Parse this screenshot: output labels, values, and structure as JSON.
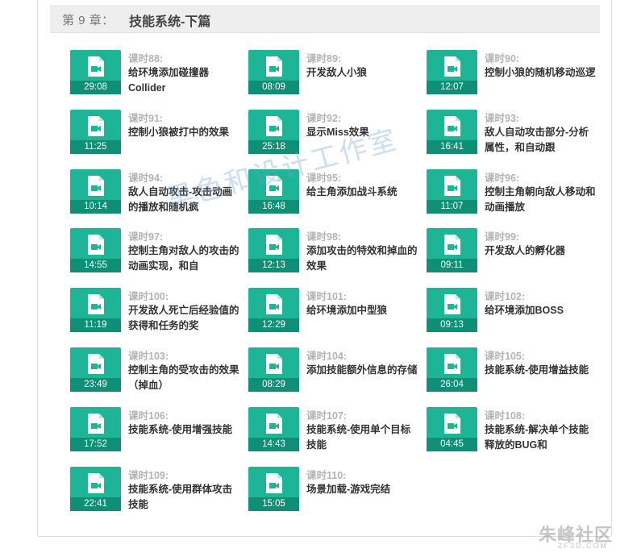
{
  "chapter": {
    "number": "第 9 章：",
    "title": "技能系统-下篇"
  },
  "lessons": [
    {
      "no": "课时88:",
      "title": "给环境添加碰撞器Collider",
      "duration": "29:08"
    },
    {
      "no": "课时89:",
      "title": "开发敌人小狼",
      "duration": "08:09"
    },
    {
      "no": "课时90:",
      "title": "控制小狼的随机移动巡逻",
      "duration": "12:07"
    },
    {
      "no": "课时91:",
      "title": "控制小狼被打中的效果",
      "duration": "11:25"
    },
    {
      "no": "课时92:",
      "title": "显示Miss效果",
      "duration": "25:18"
    },
    {
      "no": "课时93:",
      "title": "敌人自动攻击部分-分析属性，和自动跟",
      "duration": "16:41"
    },
    {
      "no": "课时94:",
      "title": "敌人自动攻击-攻击动画的播放和随机疯",
      "duration": "10:14"
    },
    {
      "no": "课时95:",
      "title": "给主角添加战斗系统",
      "duration": "16:48"
    },
    {
      "no": "课时96:",
      "title": "控制主角朝向敌人移动和动画播放",
      "duration": "11:07"
    },
    {
      "no": "课时97:",
      "title": "控制主角对敌人的攻击的动画实现，和自",
      "duration": "14:55"
    },
    {
      "no": "课时98:",
      "title": "添加攻击的特效和掉血的效果",
      "duration": "12:13"
    },
    {
      "no": "课时99:",
      "title": "开发敌人的孵化器",
      "duration": "09:11"
    },
    {
      "no": "课时100:",
      "title": "开发敌人死亡后经验值的获得和任务的奖",
      "duration": "11:19"
    },
    {
      "no": "课时101:",
      "title": "给环境添加中型狼",
      "duration": "12:29"
    },
    {
      "no": "课时102:",
      "title": "给环境添加BOSS",
      "duration": "09:13"
    },
    {
      "no": "课时103:",
      "title": "控制主角的受攻击的效果（掉血）",
      "duration": "23:49"
    },
    {
      "no": "课时104:",
      "title": "添加技能额外信息的存储",
      "duration": "08:29"
    },
    {
      "no": "课时105:",
      "title": "技能系统-使用增益技能",
      "duration": "26:04"
    },
    {
      "no": "课时106:",
      "title": "技能系统-使用增强技能",
      "duration": "17:52"
    },
    {
      "no": "课时107:",
      "title": "技能系统-使用单个目标技能",
      "duration": "14:43"
    },
    {
      "no": "课时108:",
      "title": "技能系统-解决单个技能释放的BUG和",
      "duration": "04:45"
    },
    {
      "no": "课时109:",
      "title": "技能系统-使用群体攻击技能",
      "duration": "22:41"
    },
    {
      "no": "课时110:",
      "title": "场景加载-游戏完结",
      "duration": "15:05"
    }
  ],
  "watermark": "黑色和设计工作室",
  "brand": {
    "name": "朱峰社区",
    "url": "ZF3D.COM"
  },
  "colors": {
    "thumb": "#1db596",
    "duration_bar": "#0f8f75"
  }
}
